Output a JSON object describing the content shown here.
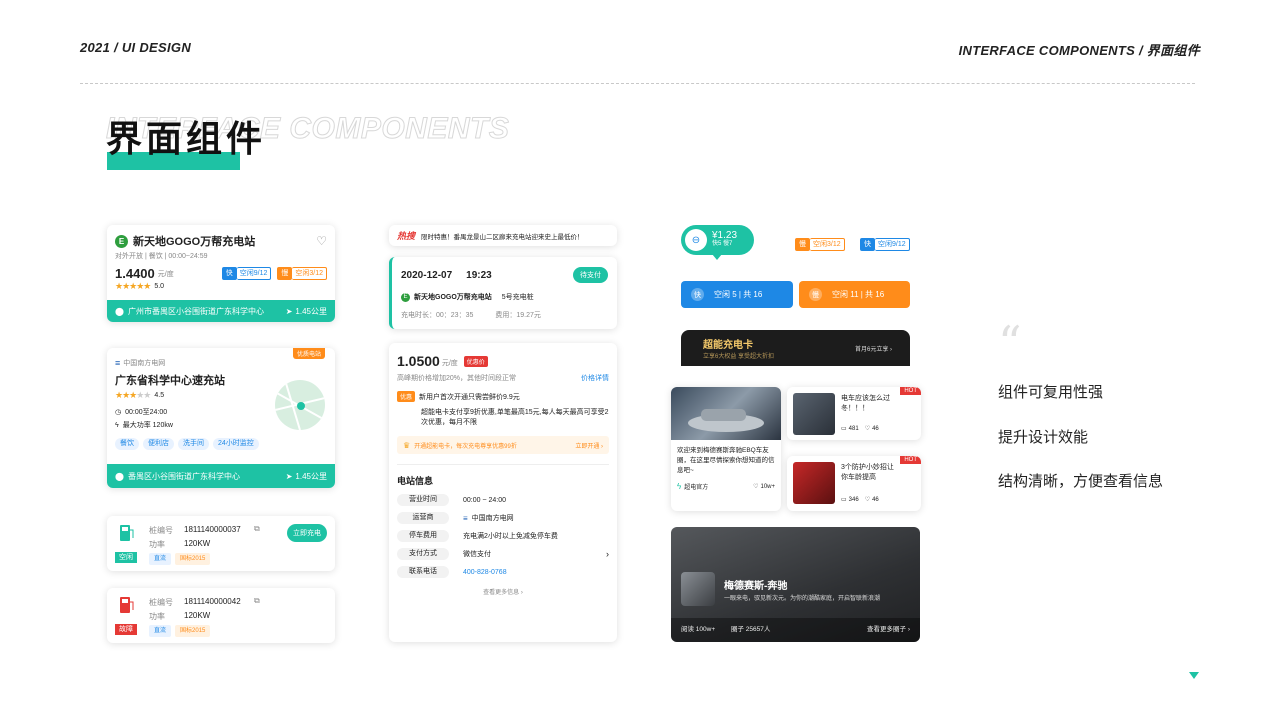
{
  "header": {
    "left": "2021 / UI DESIGN",
    "right": "INTERFACE COMPONENTS / 界面组件"
  },
  "title": {
    "cn": "界面组件",
    "en": "INTERFACE COMPONENTS"
  },
  "c1": {
    "name": "新天地GOGO万帮充电站",
    "meta": "对外开放 | 餐饮 | 00:00~24:59",
    "price": "1.4400",
    "unit": "元/度",
    "rating": "5.0",
    "fast_badge": "快",
    "fast": "空闲9/12",
    "slow_badge": "慢",
    "slow": "空闲3/12",
    "addr": "广州市番禺区小谷围街道广东科学中心",
    "dist": "1.45公里"
  },
  "c2": {
    "badge": "优质电站",
    "op": "中国南方电网",
    "name": "广东省科学中心速充站",
    "rating": "4.5",
    "hours": "00:00至24:00",
    "power": "最大功率 120kw",
    "tags": [
      "餐饮",
      "便利店",
      "洗手间",
      "24小时监控"
    ],
    "addr": "番禺区小谷围街道广东科学中心",
    "dist": "1.45公里"
  },
  "c3": {
    "label1": "桩编号",
    "value1": "1811140000037",
    "label2": "功率",
    "value2": "120KW",
    "status": "空闲",
    "tags": [
      "直流",
      "国标2015"
    ],
    "button": "立即充电"
  },
  "c4": {
    "label1": "桩编号",
    "value1": "1811140000042",
    "label2": "功率",
    "value2": "120KW",
    "status": "故障",
    "tags": [
      "直流",
      "国标2015"
    ]
  },
  "m1": {
    "logo": "热搜",
    "text": "限时特惠！番禺龙景山二区廊来充电站迎来史上最低价！"
  },
  "m2": {
    "date": "2020-12-07",
    "time": "19:23",
    "status": "待支付",
    "station": "新天地GOGO万帮充电站",
    "pile": "5号充电桩",
    "dur_label": "充电时长：",
    "dur": "00：23：35",
    "fee_label": "费用：",
    "fee": "19.27元"
  },
  "m3": {
    "price": "1.0500",
    "unit": "元/度",
    "badge": "优惠价",
    "note": "高峰期价格增加20%，其他时间段正常",
    "detail": "价格详情",
    "coupon_tag": "优惠",
    "coupon1": "新用户首次开通只需尝鲜价9.9元",
    "coupon2": "超能电卡支付享9折优惠,单笔最高15元,每人每天最高可享受2次优惠，每月不限",
    "vip": "开通超能电卡，每次充电尊享优惠99折",
    "vip_btn": "立即开通 ›",
    "info_title": "电站信息",
    "rows": [
      {
        "k": "营业时间",
        "v": "00:00 ~ 24:00"
      },
      {
        "k": "运营商",
        "v": "中国南方电网"
      },
      {
        "k": "停车费用",
        "v": "充电满2小时以上免减免停车费"
      },
      {
        "k": "支付方式",
        "v": "微信支付"
      },
      {
        "k": "联系电话",
        "v": "400-828-0768"
      }
    ],
    "more": "查看更多信息 ›"
  },
  "r1": {
    "price": "¥1.23",
    "fast": "快5",
    "slow": "慢7",
    "tag_slow": "慢",
    "tag_slow_t": "空闲3/12",
    "tag_fast": "快",
    "tag_fast_t": "空闲9/12"
  },
  "r2": {
    "blue_badge": "快",
    "blue": "空闲 5 | 共 16",
    "orange_badge": "慢",
    "orange": "空闲 11 | 共 16"
  },
  "r3": {
    "title": "超能充电卡",
    "sub": "立享6大权益 享受超大折扣",
    "btn": "首月6元立享 ›"
  },
  "news": {
    "main_text": "欢迎来到梅德赛斯奔驰EBQ车友圈，在这里尽情探索你想知道的信息吧~",
    "main_src": "超电官方",
    "main_views": "10w+",
    "a_title": "电车应该怎么过冬！！！",
    "a_c": "481",
    "a_l": "46",
    "b_title": "3个防护小妙招让你车龄提高",
    "b_c": "346",
    "b_l": "46",
    "hot": "HOT"
  },
  "club": {
    "name": "梅德赛斯-奔驰",
    "desc": "一眼来电，驭见新次元。为你的潮酷家庭，开启智联新浪潮",
    "read": "阅读 100w+",
    "members": "圈子 25657人",
    "more": "查看更多圈子 ›"
  },
  "features": [
    "组件可复用性强",
    "提升设计效能",
    "结构清晰，方便查看信息"
  ],
  "colors": {
    "teal": "#1ec2a4",
    "blue": "#1e88e5",
    "orange": "#ff8c1a",
    "red": "#e53935"
  }
}
